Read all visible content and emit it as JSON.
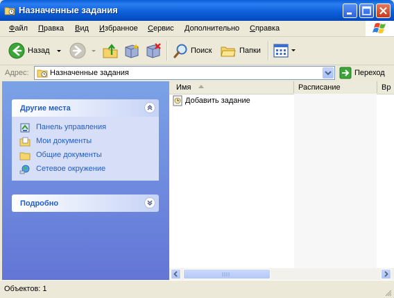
{
  "window": {
    "title": "Назначенные задания"
  },
  "menu": {
    "items": [
      {
        "underline": "Ф",
        "rest": "айл"
      },
      {
        "underline": "П",
        "rest": "равка"
      },
      {
        "underline": "В",
        "rest": "ид"
      },
      {
        "underline": "И",
        "rest": "збранное"
      },
      {
        "underline": "С",
        "rest": "ервис"
      },
      {
        "underline": "Д",
        "rest": "ополнительно"
      },
      {
        "underline": "С",
        "rest": "правка"
      }
    ]
  },
  "toolbar": {
    "back_label": "Назад",
    "search_label": "Поиск",
    "folders_label": "Папки"
  },
  "address": {
    "label": "Адрес:",
    "value": "Назначенные задания",
    "go_label": "Переход"
  },
  "left_pane": {
    "other_places": {
      "title": "Другие места",
      "links": [
        {
          "label": "Панель управления",
          "icon": "control-panel-icon"
        },
        {
          "label": "Мои документы",
          "icon": "my-documents-icon"
        },
        {
          "label": "Общие документы",
          "icon": "folder-icon"
        },
        {
          "label": "Сетевое окружение",
          "icon": "network-icon"
        }
      ]
    },
    "details": {
      "title": "Подробно"
    }
  },
  "file_list": {
    "columns": [
      "Имя",
      "Расписание",
      "Вр"
    ],
    "items": [
      {
        "name": "Добавить задание",
        "icon": "add-task-icon"
      }
    ]
  },
  "status": {
    "text": "Объектов: 1"
  },
  "colors": {
    "title_blue": "#0a5fd8",
    "task_pane_link": "#215dc6",
    "task_pane_bg": "#7ba2e7",
    "chrome": "#ece9d8"
  }
}
